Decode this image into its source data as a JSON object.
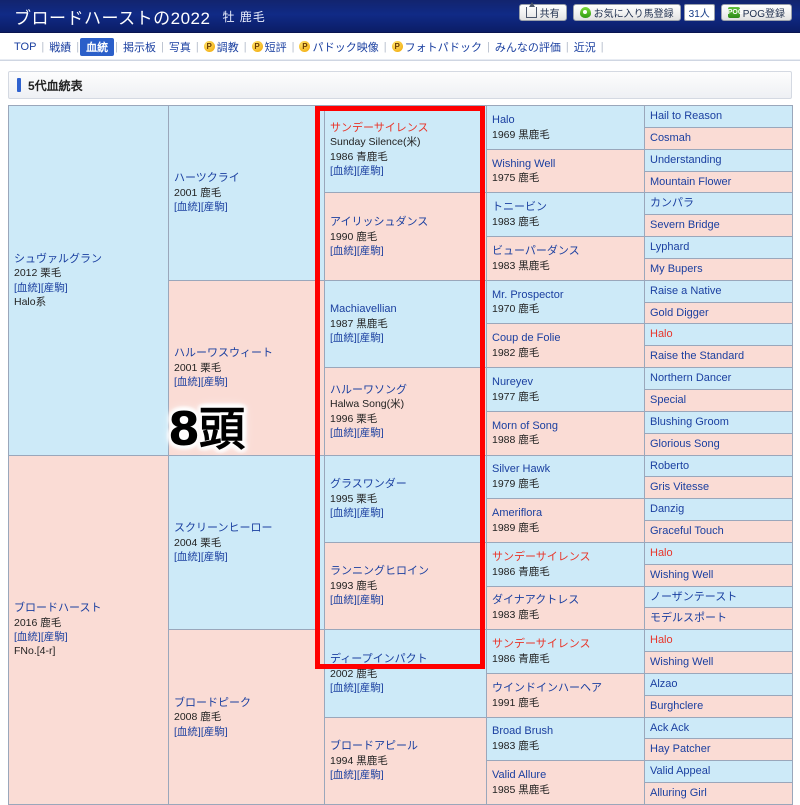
{
  "header": {
    "horse_name": "ブロードハーストの2022",
    "sex_color": "牡 鹿毛",
    "share_label": "共有",
    "favorite_label": "お気に入り馬登録",
    "favorite_count": "31人",
    "pog_label": "POG登録",
    "pog_icon_text": "POG"
  },
  "nav": {
    "items": [
      {
        "label": "TOP",
        "active": false,
        "p": false,
        "plain": false
      },
      {
        "label": "戦績",
        "active": false,
        "p": false,
        "plain": false
      },
      {
        "label": "血統",
        "active": true,
        "p": false,
        "plain": false
      },
      {
        "label": "掲示板",
        "active": false,
        "p": false,
        "plain": false
      },
      {
        "label": "写真",
        "active": false,
        "p": false,
        "plain": false
      },
      {
        "label": "調教",
        "active": false,
        "p": true,
        "plain": false
      },
      {
        "label": "短評",
        "active": false,
        "p": true,
        "plain": false
      },
      {
        "label": "パドック映像",
        "active": false,
        "p": true,
        "plain": false
      },
      {
        "label": "フォトパドック",
        "active": false,
        "p": true,
        "plain": false
      },
      {
        "label": "みんなの評価",
        "active": false,
        "p": false,
        "plain": false
      },
      {
        "label": "近況",
        "active": false,
        "p": false,
        "plain": false
      }
    ],
    "p_badge_text": "P",
    "separator": "|"
  },
  "section": {
    "title": "5代血統表"
  },
  "overlay": {
    "count_text": "8頭"
  },
  "links": {
    "pedigree": "[血統]",
    "offspring": "[産駒]"
  },
  "pedigree": {
    "gen1": [
      {
        "name": "シュヴァルグラン",
        "year": "2012 栗毛",
        "links": "[血統][産駒]",
        "extra": "Halo系",
        "sex": "m"
      },
      {
        "name": "ブロードハースト",
        "year": "2016 鹿毛",
        "links": "[血統][産駒]",
        "extra": "FNo.[4-r]",
        "sex": "f"
      }
    ],
    "gen2": [
      {
        "name": "ハーツクライ",
        "year": "2001 鹿毛",
        "links": "[血統][産駒]",
        "sex": "m"
      },
      {
        "name": "ハルーワスウィート",
        "year": "2001 栗毛",
        "links": "[血統][産駒]",
        "sex": "f"
      },
      {
        "name": "スクリーンヒーロー",
        "year": "2004 栗毛",
        "links": "[血統][産駒]",
        "sex": "m"
      },
      {
        "name": "ブロードピーク",
        "year": "2008 鹿毛",
        "links": "[血統][産駒]",
        "sex": "f"
      }
    ],
    "gen3": [
      {
        "name": "サンデーサイレンス",
        "sub": "Sunday Silence(米)",
        "year": "1986 青鹿毛",
        "links": "[血統][産駒]",
        "sex": "m",
        "red": true
      },
      {
        "name": "アイリッシュダンス",
        "sub": "",
        "year": "1990 鹿毛",
        "links": "[血統][産駒]",
        "sex": "f",
        "red": false
      },
      {
        "name": "Machiavellian",
        "sub": "",
        "year": "1987 黒鹿毛",
        "links": "[血統][産駒]",
        "sex": "m",
        "red": false
      },
      {
        "name": "ハルーワソング",
        "sub": "Halwa Song(米)",
        "year": "1996 栗毛",
        "links": "[血統][産駒]",
        "sex": "f",
        "red": false
      },
      {
        "name": "グラスワンダー",
        "sub": "",
        "year": "1995 栗毛",
        "links": "[血統][産駒]",
        "sex": "m",
        "red": false
      },
      {
        "name": "ランニングヒロイン",
        "sub": "",
        "year": "1993 鹿毛",
        "links": "[血統][産駒]",
        "sex": "f",
        "red": false
      },
      {
        "name": "ディープインパクト",
        "sub": "",
        "year": "2002 鹿毛",
        "links": "[血統][産駒]",
        "sex": "m",
        "red": false
      },
      {
        "name": "ブロードアピール",
        "sub": "",
        "year": "1994 黒鹿毛",
        "links": "[血統][産駒]",
        "sex": "f",
        "red": false
      }
    ],
    "gen4": [
      {
        "name": "Halo",
        "year": "1969 黒鹿毛",
        "sex": "m",
        "red": false
      },
      {
        "name": "Wishing Well",
        "year": "1975 鹿毛",
        "sex": "f",
        "red": false
      },
      {
        "name": "トニービン",
        "year": "1983 鹿毛",
        "sex": "m",
        "red": false
      },
      {
        "name": "ビューパーダンス",
        "year": "1983 黒鹿毛",
        "sex": "f",
        "red": false
      },
      {
        "name": "Mr. Prospector",
        "year": "1970 鹿毛",
        "sex": "m",
        "red": false
      },
      {
        "name": "Coup de Folie",
        "year": "1982 鹿毛",
        "sex": "f",
        "red": false
      },
      {
        "name": "Nureyev",
        "year": "1977 鹿毛",
        "sex": "m",
        "red": false
      },
      {
        "name": "Morn of Song",
        "year": "1988 鹿毛",
        "sex": "f",
        "red": false
      },
      {
        "name": "Silver Hawk",
        "year": "1979 鹿毛",
        "sex": "m",
        "red": false
      },
      {
        "name": "Ameriflora",
        "year": "1989 鹿毛",
        "sex": "f",
        "red": false
      },
      {
        "name": "サンデーサイレンス",
        "year": "1986 青鹿毛",
        "sex": "m",
        "red": true
      },
      {
        "name": "ダイナアクトレス",
        "year": "1983 鹿毛",
        "sex": "f",
        "red": false
      },
      {
        "name": "サンデーサイレンス",
        "year": "1986 青鹿毛",
        "sex": "m",
        "red": true
      },
      {
        "name": "ウインドインハーヘア",
        "year": "1991 鹿毛",
        "sex": "f",
        "red": false
      },
      {
        "name": "Broad Brush",
        "year": "1983 鹿毛",
        "sex": "m",
        "red": false
      },
      {
        "name": "Valid Allure",
        "year": "1985 黒鹿毛",
        "sex": "f",
        "red": false
      }
    ],
    "gen5": [
      {
        "name": "Hail to Reason",
        "sex": "m",
        "red": false
      },
      {
        "name": "Cosmah",
        "sex": "f",
        "red": false
      },
      {
        "name": "Understanding",
        "sex": "m",
        "red": false
      },
      {
        "name": "Mountain Flower",
        "sex": "f",
        "red": false
      },
      {
        "name": "カンパラ",
        "sex": "m",
        "red": false
      },
      {
        "name": "Severn Bridge",
        "sex": "f",
        "red": false
      },
      {
        "name": "Lyphard",
        "sex": "m",
        "red": false
      },
      {
        "name": "My Bupers",
        "sex": "f",
        "red": false
      },
      {
        "name": "Raise a Native",
        "sex": "m",
        "red": false
      },
      {
        "name": "Gold Digger",
        "sex": "f",
        "red": false
      },
      {
        "name": "Halo",
        "sex": "m",
        "red": true
      },
      {
        "name": "Raise the Standard",
        "sex": "f",
        "red": false
      },
      {
        "name": "Northern Dancer",
        "sex": "m",
        "red": false
      },
      {
        "name": "Special",
        "sex": "f",
        "red": false
      },
      {
        "name": "Blushing Groom",
        "sex": "m",
        "red": false
      },
      {
        "name": "Glorious Song",
        "sex": "f",
        "red": false
      },
      {
        "name": "Roberto",
        "sex": "m",
        "red": false
      },
      {
        "name": "Gris Vitesse",
        "sex": "f",
        "red": false
      },
      {
        "name": "Danzig",
        "sex": "m",
        "red": false
      },
      {
        "name": "Graceful Touch",
        "sex": "f",
        "red": false
      },
      {
        "name": "Halo",
        "sex": "m",
        "red": true
      },
      {
        "name": "Wishing Well",
        "sex": "f",
        "red": false
      },
      {
        "name": "ノーザンテースト",
        "sex": "m",
        "red": false
      },
      {
        "name": "モデルスポート",
        "sex": "f",
        "red": false
      },
      {
        "name": "Halo",
        "sex": "m",
        "red": true
      },
      {
        "name": "Wishing Well",
        "sex": "f",
        "red": false
      },
      {
        "name": "Alzao",
        "sex": "m",
        "red": false
      },
      {
        "name": "Burghclere",
        "sex": "f",
        "red": false
      },
      {
        "name": "Ack Ack",
        "sex": "m",
        "red": false
      },
      {
        "name": "Hay Patcher",
        "sex": "f",
        "red": false
      },
      {
        "name": "Valid Appeal",
        "sex": "m",
        "red": false
      },
      {
        "name": "Alluring Girl",
        "sex": "f",
        "red": false
      }
    ]
  }
}
